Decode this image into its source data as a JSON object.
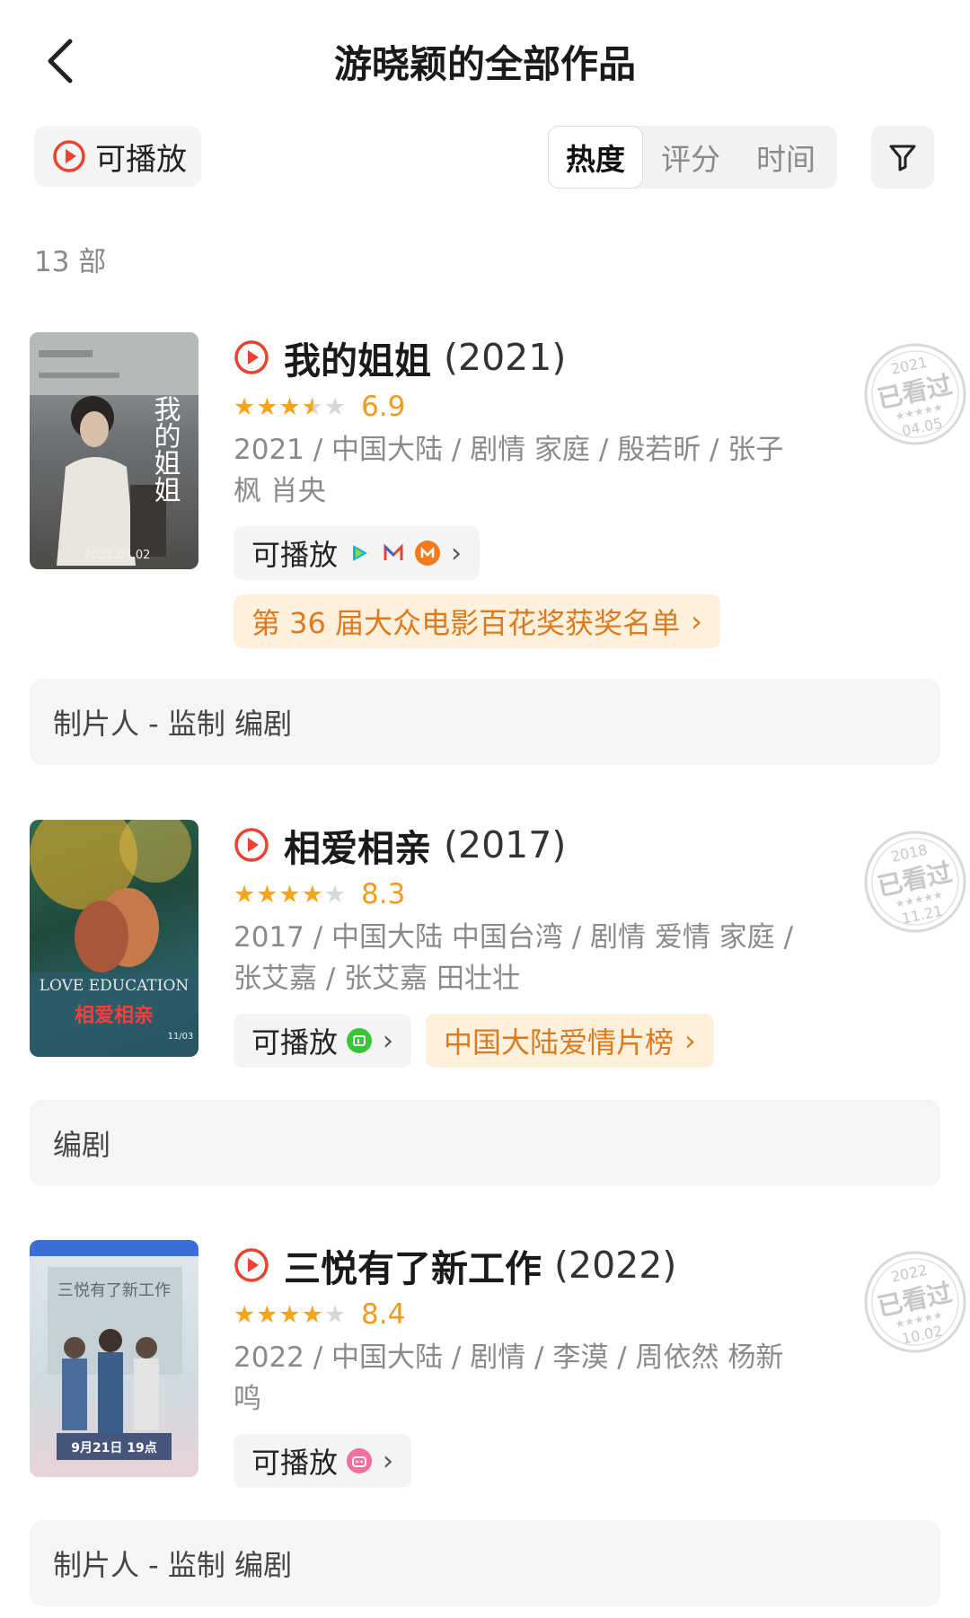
{
  "header": {
    "title": "游晓颖的全部作品"
  },
  "toolbar": {
    "playable_label": "可播放",
    "sort_tabs": [
      "热度",
      "评分",
      "时间"
    ],
    "active_sort": "热度"
  },
  "count_label": "13 部",
  "colors": {
    "accent": "#e8432e",
    "star": "#f6a41c",
    "award_text": "#dc7a1d",
    "award_bg": "#fdf0dd"
  },
  "works": [
    {
      "title": "我的姐姐",
      "year": "(2021)",
      "stars": 3.5,
      "score": "6.9",
      "meta": "2021 / 中国大陆 / 剧情 家庭 / 殷若昕 / 张子枫 肖央",
      "play_label": "可播放",
      "platforms": [
        "tencent-video-icon",
        "mgtv-m-icon",
        "mango-tv-icon"
      ],
      "award": "第 36 届大众电影百花奖获奖名单",
      "role": "制片人 - 监制 编剧",
      "watched_stamp": {
        "year": "2021",
        "text": "已看过",
        "date": "04.05"
      },
      "poster": {
        "title": "我的姐姐",
        "date": "2021.04.02"
      }
    },
    {
      "title": "相爱相亲",
      "year": "(2017)",
      "stars": 4,
      "score": "8.3",
      "meta": "2017 / 中国大陆 中国台湾 / 剧情 爱情 家庭 / 张艾嘉 / 张艾嘉 田壮壮",
      "play_label": "可播放",
      "platforms": [
        "iqiyi-icon"
      ],
      "award": "中国大陆爱情片榜",
      "role": "编剧",
      "watched_stamp": {
        "year": "2018",
        "text": "已看过",
        "date": "11.21"
      },
      "poster": {
        "title": "相爱相亲",
        "english": "LOVE EDUCATION",
        "date": "11/03"
      }
    },
    {
      "title": "三悦有了新工作",
      "year": "(2022)",
      "stars": 4,
      "score": "8.4",
      "meta": "2022 / 中国大陆 / 剧情 / 李漠 / 周依然 杨新鸣",
      "play_label": "可播放",
      "platforms": [
        "bilibili-icon"
      ],
      "award": "",
      "role": "制片人 - 监制 编剧",
      "watched_stamp": {
        "year": "2022",
        "text": "已看过",
        "date": "10.02"
      },
      "poster": {
        "title": "三悦有了新工作",
        "date": "9月21日 19点"
      }
    }
  ]
}
